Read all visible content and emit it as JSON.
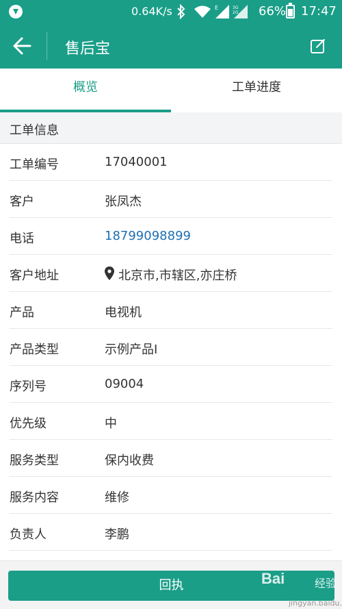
{
  "status_bar": {
    "network_speed": "0.64K/s",
    "battery_percent": "66%",
    "battery_level": 0.66,
    "time": "17:47"
  },
  "app_bar": {
    "title": "售后宝",
    "back_icon": "arrow-left-icon",
    "edit_icon": "edit-icon"
  },
  "tabs": [
    {
      "label": "概览",
      "active": true
    },
    {
      "label": "工单进度",
      "active": false
    }
  ],
  "section": {
    "title": "工单信息"
  },
  "fields": [
    {
      "label": "工单编号",
      "value": "17040001"
    },
    {
      "label": "客户",
      "value": "张凤杰"
    },
    {
      "label": "电话",
      "value": "18799098899"
    },
    {
      "label": "客户地址",
      "value": "北京市,市辖区,亦庄桥"
    },
    {
      "label": "产品",
      "value": "电视机"
    },
    {
      "label": "产品类型",
      "value": "示例产品I"
    },
    {
      "label": "序列号",
      "value": "09004"
    },
    {
      "label": "优先级",
      "value": "中"
    },
    {
      "label": "服务类型",
      "value": "保内收费"
    },
    {
      "label": "服务内容",
      "value": "维修"
    },
    {
      "label": "负责人",
      "value": "李鹏"
    }
  ],
  "footer": {
    "reply_label": "回执"
  },
  "watermark": {
    "brand": "Bai",
    "brand_cn": "经验",
    "url": "jingyan.baidu.com"
  },
  "colors": {
    "primary": "#1a9e88",
    "link": "#1d6fb2"
  }
}
